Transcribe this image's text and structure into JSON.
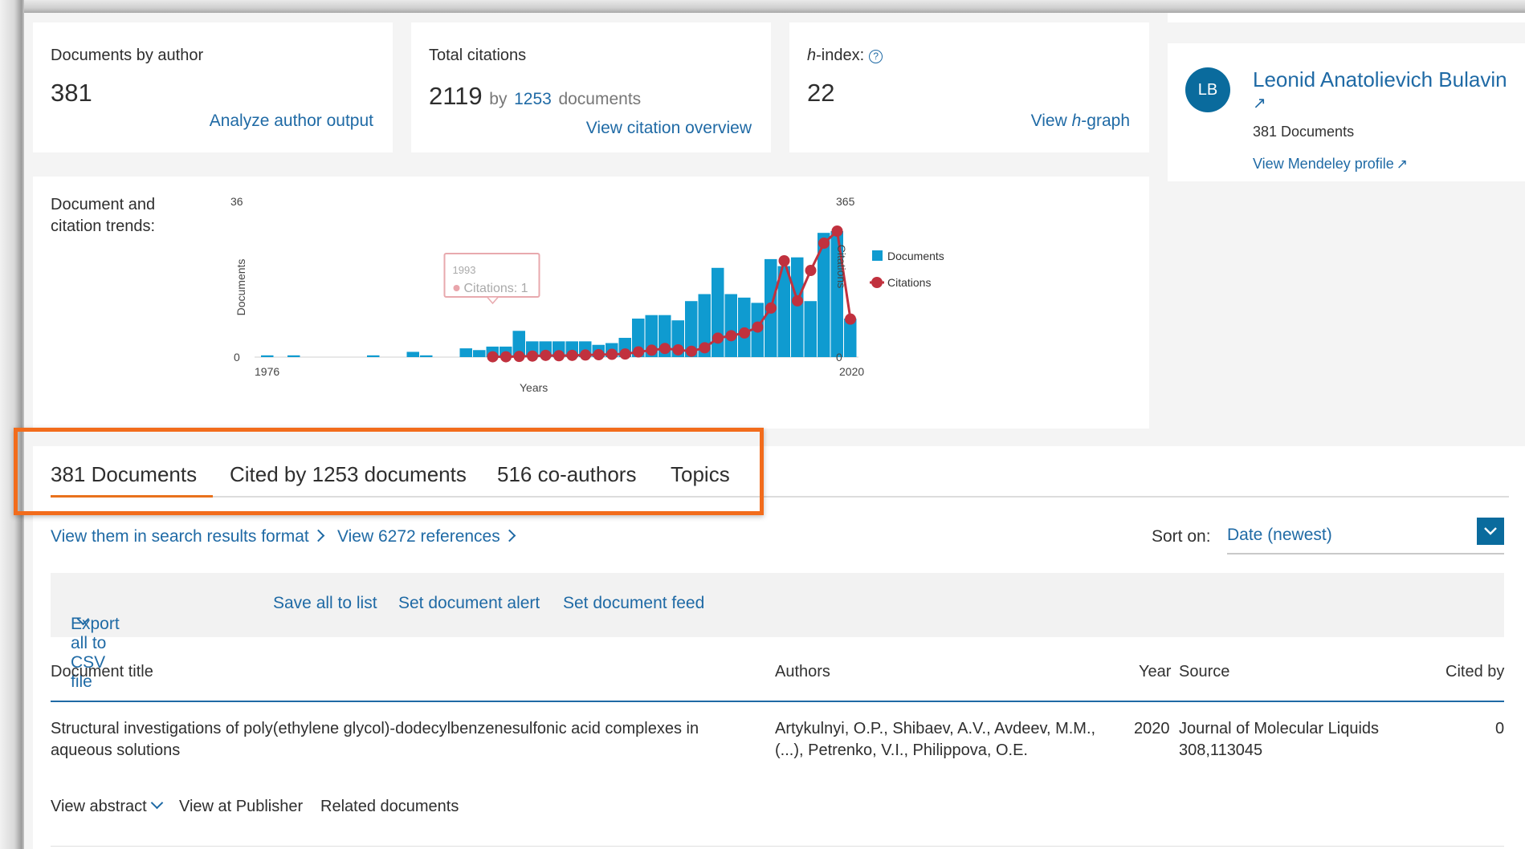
{
  "metrics": {
    "documents": {
      "label": "Documents by author",
      "value": "381",
      "link": "Analyze author output"
    },
    "citations": {
      "label": "Total citations",
      "value": "2119",
      "by": "by",
      "doc_count": "1253",
      "docs_word": "documents",
      "link": "View citation overview"
    },
    "hindex": {
      "label_h": "h",
      "label_rest": "-index:",
      "help_icon": "?",
      "value": "22",
      "link_pre": "View ",
      "link_h": "h",
      "link_post": "-graph"
    }
  },
  "profile": {
    "initials": "LB",
    "name": "Leonid Anatolievich Bulavin",
    "external_icon": "↗",
    "doc_count": "381 Documents",
    "mendeley_link": "View Mendeley profile"
  },
  "chart_section": {
    "label_line1": "Document and",
    "label_line2": "citation trends:"
  },
  "chart_data": {
    "type": "bar+line",
    "x_label": "Years",
    "x_tick_labels": [
      "1976",
      "2020"
    ],
    "y_left_label": "Documents",
    "y_left_ticks": [
      "0",
      "36"
    ],
    "y_left_range": [
      0,
      36
    ],
    "y_right_label": "Citations",
    "y_right_ticks": [
      "0",
      "365"
    ],
    "y_right_range": [
      0,
      365
    ],
    "legend_position": "right",
    "colors": {
      "documents": "#0f9bd0",
      "citations": "#c1313e"
    },
    "series": [
      {
        "name": "Documents",
        "type": "bar",
        "x": [
          1976,
          1977,
          1978,
          1979,
          1980,
          1981,
          1982,
          1983,
          1984,
          1985,
          1986,
          1987,
          1988,
          1989,
          1990,
          1991,
          1992,
          1993,
          1994,
          1995,
          1996,
          1997,
          1998,
          1999,
          2000,
          2001,
          2002,
          2003,
          2004,
          2005,
          2006,
          2007,
          2008,
          2009,
          2010,
          2011,
          2012,
          2013,
          2014,
          2015,
          2016,
          2017,
          2018,
          2019,
          2020
        ],
        "y": [
          0.5,
          0,
          0.5,
          0,
          0,
          0,
          0,
          0,
          0.5,
          0,
          0,
          1.5,
          0.5,
          0,
          0,
          2.5,
          2,
          3,
          3,
          7.5,
          4.5,
          4.5,
          4.5,
          4.5,
          4.5,
          3.5,
          4,
          5.5,
          11,
          12,
          12,
          10.5,
          16,
          18,
          25.5,
          18,
          17,
          15.5,
          28,
          26,
          28.5,
          16,
          35.5,
          36,
          11
        ]
      },
      {
        "name": "Citations",
        "type": "line",
        "x": [
          1993,
          1994,
          1995,
          1996,
          1997,
          1998,
          1999,
          2000,
          2001,
          2002,
          2003,
          2004,
          2005,
          2006,
          2007,
          2008,
          2009,
          2010,
          2011,
          2012,
          2013,
          2014,
          2015,
          2016,
          2017,
          2018,
          2019,
          2020
        ],
        "y": [
          1,
          1,
          2,
          3,
          5,
          4,
          5,
          6,
          7,
          8,
          9,
          15,
          20,
          25,
          21,
          17,
          27,
          55,
          62,
          70,
          87,
          142,
          279,
          163,
          251,
          330,
          365,
          110
        ]
      }
    ],
    "tooltip": {
      "year": "1993",
      "text": "Citations: 1"
    }
  },
  "tabs": [
    {
      "label": "381 Documents",
      "active": true
    },
    {
      "label": "Cited by 1253 documents",
      "active": false
    },
    {
      "label": "516 co-authors",
      "active": false
    },
    {
      "label": "Topics",
      "active": false
    }
  ],
  "results_links": {
    "search_format": "View them in search results format",
    "references": "View 6272 references"
  },
  "sort": {
    "label": "Sort on:",
    "value": "Date (newest)"
  },
  "toolbar": {
    "export": "Export all to CSV file",
    "save": "Save all to list",
    "alert": "Set document alert",
    "feed": "Set document feed"
  },
  "table": {
    "headers": {
      "title": "Document title",
      "authors": "Authors",
      "year": "Year",
      "source": "Source",
      "cited": "Cited by"
    },
    "rows": [
      {
        "title_line1": "Structural investigations of poly(ethylene glycol)-dodecylbenzenesulfonic acid complexes in",
        "title_line2": "aqueous solutions",
        "authors_line1": "Artykulnyi, O.P., Shibaev, A.V., Avdeev, M.M.,",
        "authors_line2": "(...), Petrenko, V.I., Philippova, O.E.",
        "year": "2020",
        "source_line1": "Journal of Molecular Liquids",
        "source_line2": "308,113045",
        "cited": "0",
        "actions": {
          "abstract": "View abstract",
          "publisher": "View at Publisher",
          "related": "Related documents"
        }
      }
    ]
  }
}
